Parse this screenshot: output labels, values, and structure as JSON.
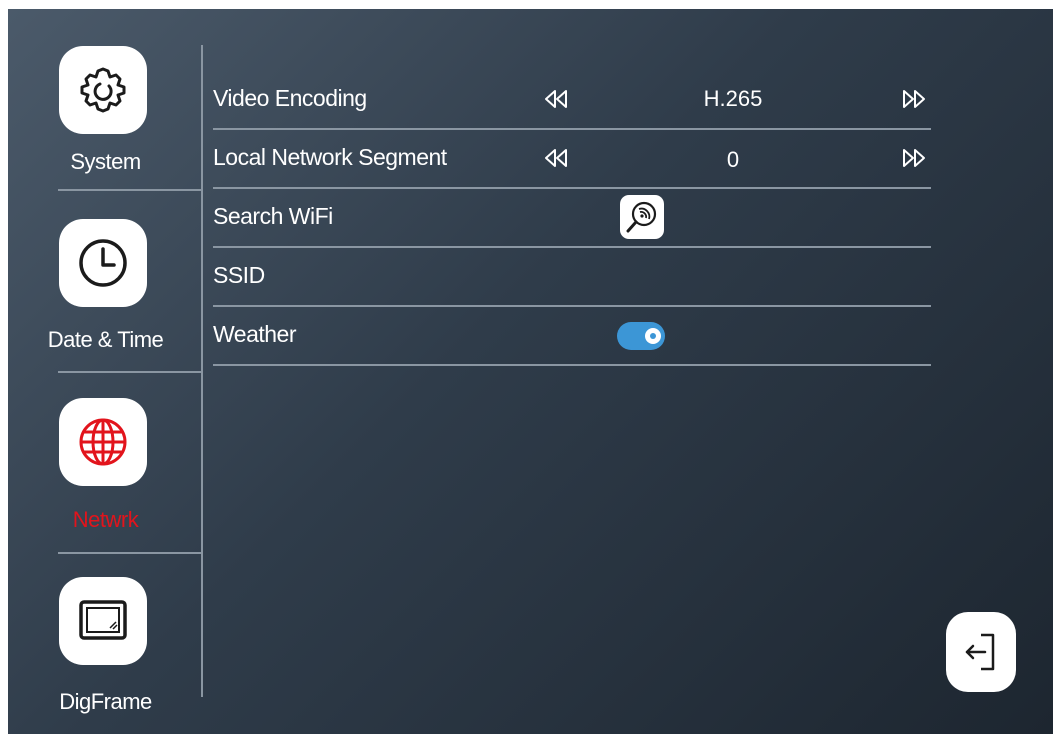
{
  "sidebar": {
    "items": [
      {
        "label": "System",
        "icon": "gear-icon"
      },
      {
        "label": "Date & Time",
        "icon": "clock-icon"
      },
      {
        "label": "Netwrk",
        "icon": "globe-icon",
        "active": true
      },
      {
        "label": "DigFrame",
        "icon": "picture-frame-icon"
      }
    ]
  },
  "settings": {
    "video_encoding": {
      "label": "Video Encoding",
      "value": "H.265"
    },
    "local_network_segment": {
      "label": "Local Network Segment",
      "value": "0"
    },
    "search_wifi": {
      "label": "Search WiFi",
      "icon": "wifi-search-icon"
    },
    "ssid": {
      "label": "SSID"
    },
    "weather": {
      "label": "Weather",
      "enabled": true
    }
  },
  "exit": {
    "icon": "exit-icon"
  },
  "colors": {
    "active": "#e2141c",
    "toggle_on": "#3c96d6",
    "divider": "#8a96a2",
    "text": "#ffffff"
  }
}
